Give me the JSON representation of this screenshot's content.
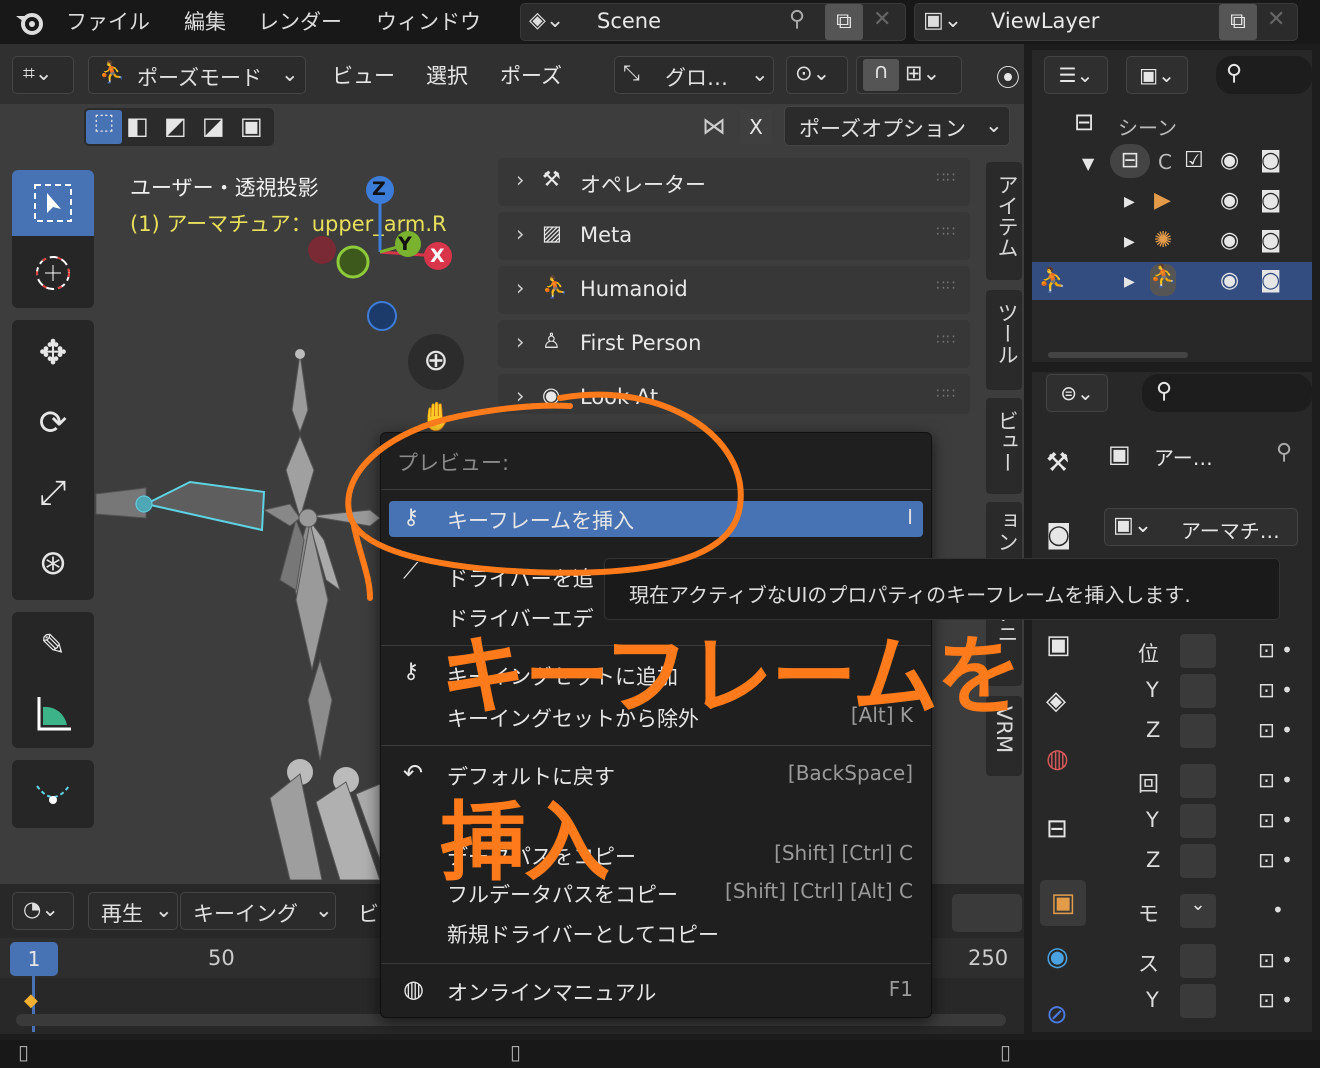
{
  "topbar": {
    "menus": [
      "ファイル",
      "編集",
      "レンダー",
      "ウィンドウ"
    ],
    "scene": "Scene",
    "view_layer": "ViewLayer"
  },
  "viewport_header": {
    "mode": "ポーズモード",
    "menus": [
      "ビュー",
      "選択",
      "ポーズ"
    ],
    "transform": "グロ…",
    "pose_options": "ポーズオプション",
    "x_label": "X"
  },
  "viewport": {
    "view_name": "ユーザー・透視投影",
    "active_object": "(1) アーマチュア：upper_arm.R",
    "gizmo": {
      "z": "Z",
      "y": "Y",
      "x": "X"
    }
  },
  "sidebar_panels": [
    "オペレーター",
    "Meta",
    "Humanoid",
    "First Person",
    "Look At"
  ],
  "sidebar_tabs": [
    "アイテム",
    "ツール",
    "ビュー",
    "ョン",
    "アニ",
    "VRM"
  ],
  "context_menu": {
    "header": "プレビュー:",
    "items": [
      {
        "label": "キーフレームを挿入",
        "shortcut": "I"
      },
      {
        "label": "ドライバーを追",
        "shortcut": ""
      },
      {
        "label": "ドライバーエデ",
        "shortcut": ""
      },
      {
        "label": "キーイングセットに追加",
        "shortcut": ""
      },
      {
        "label": "キーイングセットから除外",
        "shortcut": "[Alt] K"
      },
      {
        "label": "デフォルトに戻す",
        "shortcut": "[BackSpace]"
      },
      {
        "label": "データパスをコピー",
        "shortcut": "[Shift] [Ctrl] C"
      },
      {
        "label": "フルデータパスをコピー",
        "shortcut": "[Shift] [Ctrl] [Alt] C"
      },
      {
        "label": "新規ドライバーとしてコピー",
        "shortcut": ""
      },
      {
        "label": "オンラインマニュアル",
        "shortcut": "F1"
      }
    ]
  },
  "tooltip": "現在アクティブなUIのプロパティのキーフレームを挿入します.",
  "annotation": {
    "line1": "キーフレームを",
    "line2": "挿入",
    "color": "#ff7a1a"
  },
  "outliner": {
    "scene": "シーン",
    "collection": "C"
  },
  "properties": {
    "name1": "アー…",
    "name2": "アーマチ…",
    "rows": [
      "位",
      "Y",
      "Z",
      "回",
      "Y",
      "Z",
      "モ",
      "ス",
      "Y"
    ]
  },
  "timeline": {
    "playback": "再生",
    "keying": "キーイング",
    "view_short": "ビ",
    "current_frame": "1",
    "mark_50": "50",
    "mark_250": "250"
  }
}
